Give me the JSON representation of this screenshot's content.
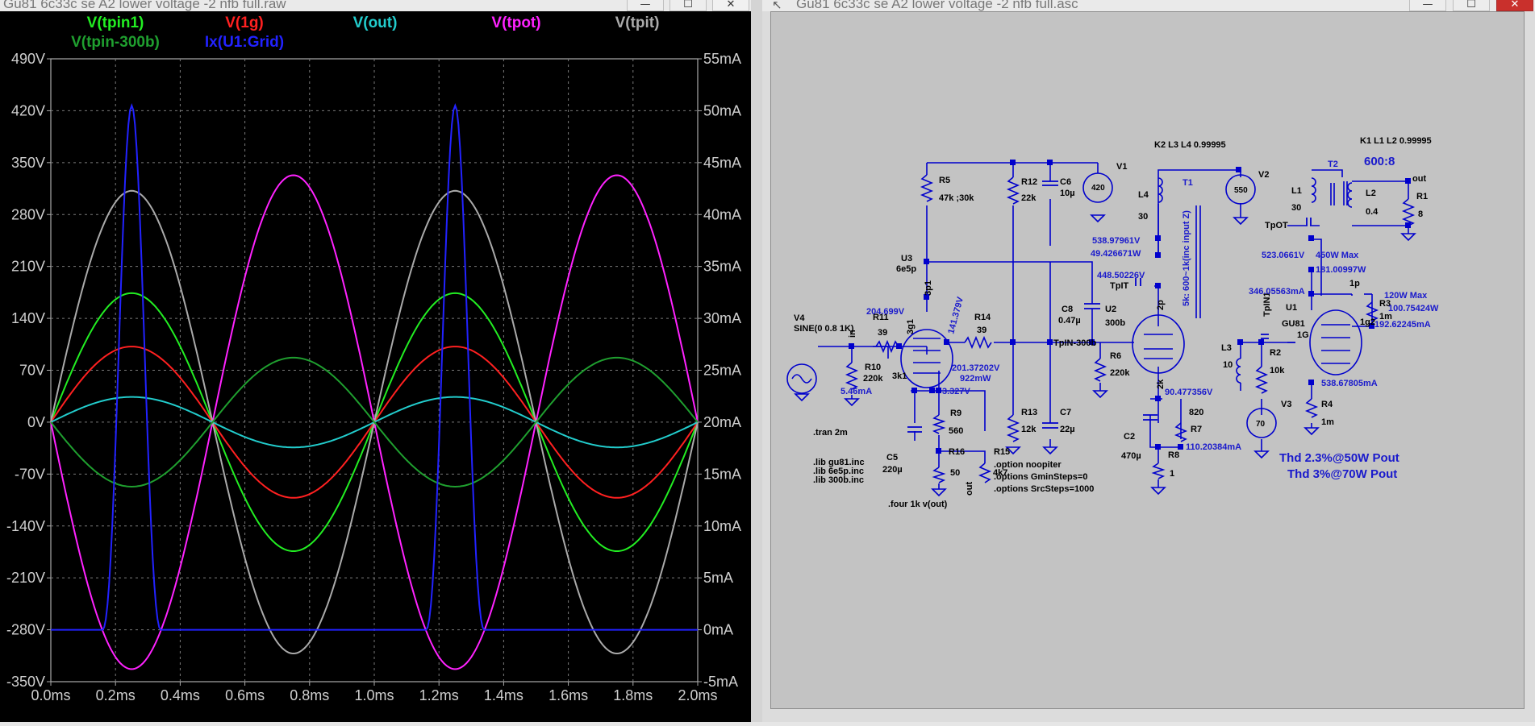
{
  "waveform_window": {
    "title": "Gu81 6c33c se A2 lower voltage -2 nfb full.raw",
    "buttons": {
      "minimize": "—",
      "maximize": "☐",
      "close": "✕"
    },
    "traces": [
      {
        "label": "V(tpin1)",
        "color": "#22ee22"
      },
      {
        "label": "V(1g)",
        "color": "#ff2020"
      },
      {
        "label": "V(out)",
        "color": "#22cccc"
      },
      {
        "label": "V(tpot)",
        "color": "#ff22ff"
      },
      {
        "label": "V(tpit)",
        "color": "#aaaaaa"
      },
      {
        "label": "V(tpin-300b)",
        "color": "#1f9f2f"
      },
      {
        "label": "Ix(U1:Grid)",
        "color": "#2222ff"
      }
    ],
    "left_ticks": [
      "490V",
      "420V",
      "350V",
      "280V",
      "210V",
      "140V",
      "70V",
      "0V",
      "-70V",
      "-140V",
      "-210V",
      "-280V",
      "-350V"
    ],
    "right_ticks": [
      "55mA",
      "50mA",
      "45mA",
      "40mA",
      "35mA",
      "30mA",
      "25mA",
      "20mA",
      "15mA",
      "10mA",
      "5mA",
      "0mA",
      "-5mA"
    ],
    "x_ticks": [
      "0.0ms",
      "0.2ms",
      "0.4ms",
      "0.6ms",
      "0.8ms",
      "1.0ms",
      "1.2ms",
      "1.4ms",
      "1.6ms",
      "1.8ms",
      "2.0ms"
    ]
  },
  "chart_data": {
    "type": "line",
    "x": [
      0.0,
      2.0
    ],
    "xlabel_unit": "ms",
    "ylim_left": [
      -350,
      490
    ],
    "ylim_right": [
      -5,
      55
    ],
    "grid": true,
    "series": [
      {
        "name": "V(tpin1)",
        "axis": "left",
        "kind": "sine",
        "amplitude": 174,
        "offset": 0,
        "period_ms": 1.0,
        "phase": 0
      },
      {
        "name": "V(1g)",
        "axis": "left",
        "kind": "sine",
        "amplitude": 102,
        "offset": 0,
        "period_ms": 1.0,
        "phase": 0
      },
      {
        "name": "V(out)",
        "axis": "left",
        "kind": "sine",
        "amplitude": 34,
        "offset": 0,
        "period_ms": 1.0,
        "phase": 0
      },
      {
        "name": "V(tpot)",
        "axis": "left",
        "kind": "sine",
        "amplitude": -333,
        "offset": 0,
        "period_ms": 1.0,
        "phase": 0
      },
      {
        "name": "V(tpit)",
        "axis": "left",
        "kind": "sine",
        "amplitude": 312,
        "offset": 0,
        "period_ms": 1.0,
        "phase": 0
      },
      {
        "name": "V(tpin-300b)",
        "axis": "left",
        "kind": "sine",
        "amplitude": -87,
        "offset": 0,
        "period_ms": 1.0,
        "phase": 0
      },
      {
        "name": "Ix(U1:Grid)",
        "axis": "right",
        "kind": "clipped-peak",
        "peak": 50.5,
        "base": 0,
        "peak_times_ms": [
          0.25,
          1.25
        ],
        "half_width_ms": 0.09
      }
    ]
  },
  "schematic_window": {
    "title": "Gu81 6c33c se A2 lower voltage -2 nfb full.asc",
    "title_icon": "↖",
    "buttons": {
      "minimize": "—",
      "maximize": "☐",
      "close": "✕"
    },
    "labels": {
      "k2": "K2  L3 L4 0.99995",
      "k1": "K1 L1 L2 0.99995",
      "ratio": "600:8",
      "v1": "V1",
      "v1_val": "420",
      "v2": "V2",
      "v2_val": "550",
      "v3": "V3",
      "v3_val": "70",
      "v4": "V4",
      "v4_val": "SINE(0 0.8 1K)",
      "r5": "R5",
      "r5_val": "47k ;30k",
      "r12": "R12",
      "r12_val": "22k",
      "c6": "C6",
      "c6_val": "10µ",
      "l4": "L4",
      "l4_val": "30",
      "t1": "T1",
      "t1_note": "5k: 600~1k(inc input Z)",
      "l1": "L1",
      "l1_val": "30",
      "t2": "T2",
      "l2": "L2",
      "l2_val": "0.4",
      "r1": "R1",
      "r1_val": "8",
      "out": "out",
      "tpot": "TpOT",
      "u3": "U3",
      "u3_val": "6e5p",
      "pin3p1": "3p1",
      "r14": "R14",
      "r14_val": "39",
      "c8": "C8",
      "c8_val": "0.47µ",
      "u2": "U2",
      "u2_val": "300b",
      "tpit": "TpIT",
      "pin2p": "2p",
      "tpin1": "TpIN1",
      "u1": "U1",
      "u1_val": "GU81",
      "pin1p": "1p",
      "pin1g": "1G",
      "pin1g2": "1g2",
      "r3": "R3",
      "r3_val": "1m",
      "r11": "R11",
      "r11_val": "39",
      "pin3g1": "3g1",
      "in_label": "in",
      "r10": "R10",
      "r10_val": "220k",
      "pin3k1": "3k1",
      "tpin300b": "TpIN-300b",
      "r6": "R6",
      "r6_val": "220k",
      "pin2k": "2k",
      "l3": "L3",
      "l3_val": "10",
      "r2": "R2",
      "r2_val": "10k",
      "r9": "R9",
      "r9_val": "560",
      "r13": "R13",
      "r13_val": "12k",
      "c7": "C7",
      "c7_val": "22µ",
      "c2": "C2",
      "c2_val": "470µ",
      "r7": "R7",
      "r7_val": "820",
      "r8": "R8",
      "r8_val": "1",
      "r4": "R4",
      "r4_val": "1m",
      "c5": "C5",
      "c5_val": "220µ",
      "r16": "R16",
      "r16_val": "50",
      "r15": "R15",
      "r15_val": "4k7",
      "out2": "out",
      "tran": ".tran 2m",
      "lib1": ".lib gu81.inc",
      "lib2": ".lib 6e5p.inc",
      "lib3": ".lib 300b.inc",
      "four": ".four 1k v(out)",
      "opt1": ".option noopiter",
      "opt2": ".options GminSteps=0",
      "opt3": ".options SrcSteps=1000",
      "thd1": "Thd 2.3%@50W Pout",
      "thd2": "Thd 3%@70W Pout"
    },
    "readouts": {
      "v538_97": "538.97961V",
      "w49_42": "49.426671W",
      "v448_50": "448.50226V",
      "v204_69": "204.699V",
      "w141_37": "141.379V",
      "v201_37": "201.37202V",
      "mw922": "922mW",
      "ma5_46": "5.46mA",
      "v3_327": "3.327V",
      "v90_47": "90.477356V",
      "ma110_20": "110.20384mA",
      "v523_06": "523.0661V",
      "w450max": "450W Max",
      "w181_00": "181.00997W",
      "ma346_05": "346.05563mA",
      "w120max": "120W Max",
      "w100_75": "100.75424W",
      "ma192_62": "192.62245mA",
      "ma538_67": "538.67805mA"
    }
  }
}
